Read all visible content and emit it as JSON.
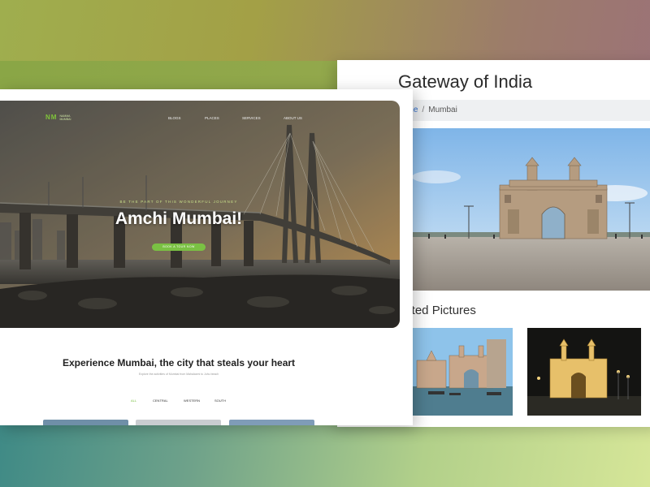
{
  "detail_page": {
    "title": "Gateway of India",
    "breadcrumb": {
      "home": "ome",
      "separator": "/",
      "current": "Mumbai"
    },
    "related_title": "lated Pictures"
  },
  "site": {
    "logo": {
      "mark": "NM",
      "text": "NAMMA MUMBAI"
    },
    "nav": [
      "BLOGS",
      "PLACES",
      "SERVICES",
      "ABOUT US"
    ],
    "hero": {
      "tagline": "BE THE PART OF THIS WONDERFUL JOURNEY",
      "title": "Amchi Mumbai!",
      "cta": "BOOK A TOUR NOW"
    },
    "section": {
      "title": "Experience Mumbai, the city that steals your heart",
      "subtitle": "Explore the activities of Mumbai from Mahalaxmi to Juhu beach"
    },
    "filters": [
      "ALL",
      "CENTRAL",
      "WESTERN",
      "SOUTH"
    ],
    "active_filter": "ALL"
  },
  "colors": {
    "accent_green": "#7ac143",
    "link_blue": "#2f6fd1"
  }
}
